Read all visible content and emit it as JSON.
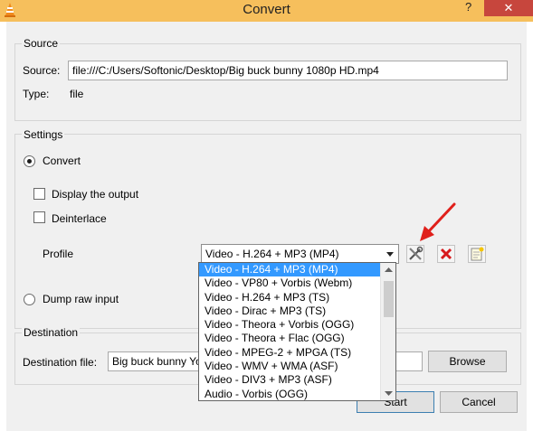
{
  "window": {
    "title": "Convert",
    "help_label": "?",
    "close_label": "✕"
  },
  "source": {
    "group_title": "Source",
    "source_label": "Source:",
    "source_value": "file:///C:/Users/Softonic/Desktop/Big buck bunny 1080p HD.mp4",
    "type_label": "Type:",
    "type_value": "file"
  },
  "settings": {
    "group_title": "Settings",
    "convert_label": "Convert",
    "convert_selected": true,
    "display_output_label": "Display the output",
    "display_output_checked": false,
    "deinterlace_label": "Deinterlace",
    "deinterlace_checked": false,
    "profile_label": "Profile",
    "profile_selected": "Video - H.264 + MP3 (MP4)",
    "dump_raw_label": "Dump raw input",
    "dump_raw_selected": false
  },
  "profile_options": [
    "Video - H.264 + MP3 (MP4)",
    "Video - VP80 + Vorbis (Webm)",
    "Video - H.264 + MP3 (TS)",
    "Video - Dirac + MP3 (TS)",
    "Video - Theora + Vorbis (OGG)",
    "Video - Theora + Flac (OGG)",
    "Video - MPEG-2 + MPGA (TS)",
    "Video - WMV + WMA (ASF)",
    "Video - DIV3 + MP3 (ASF)",
    "Audio - Vorbis (OGG)"
  ],
  "destination": {
    "group_title": "Destination",
    "file_label": "Destination file:",
    "file_value": "Big buck bunny Yo",
    "browse_label": "Browse"
  },
  "footer": {
    "start_label": "Start",
    "cancel_label": "Cancel"
  },
  "colors": {
    "titlebar": "#f6bf5c",
    "close": "#c7463d",
    "selection": "#3399ff",
    "annotation_arrow": "#e0201b"
  },
  "icons": {
    "edit_profile": "wrench-screwdriver-icon",
    "delete_profile": "red-x-icon",
    "new_profile": "new-document-icon"
  }
}
